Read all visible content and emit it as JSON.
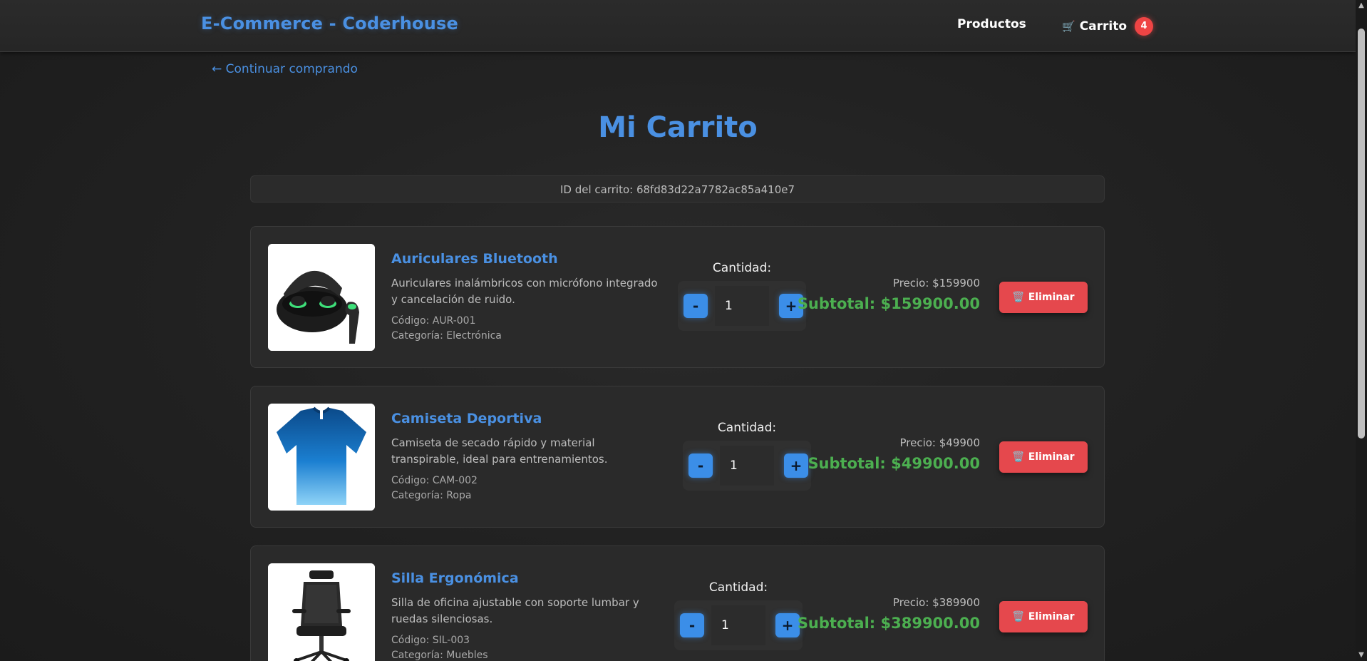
{
  "header": {
    "brand": "E-Commerce - Coderhouse",
    "nav_products": "Productos",
    "nav_cart": "Carrito",
    "cart_icon": "🛒",
    "cart_count": "4"
  },
  "back_link": "← Continuar comprando",
  "page_title": "Mi Carrito",
  "cart_id": "ID del carrito: 68fd83d22a7782ac85a410e7",
  "items": [
    {
      "name": "Auriculares Bluetooth",
      "description": "Auriculares inalámbricos con micrófono integrado y cancelación de ruido.",
      "code": "Código: AUR-001",
      "category": "Categoría: Electrónica",
      "qty_label": "Cantidad:",
      "minus": "-",
      "plus": "+",
      "quantity": "1",
      "price": "Precio: $159900",
      "subtotal": "Subtotal: $159900.00",
      "remove": "🗑️ Eliminar"
    },
    {
      "name": "Camiseta Deportiva",
      "description": "Camiseta de secado rápido y material transpirable, ideal para entrenamientos.",
      "code": "Código: CAM-002",
      "category": "Categoría: Ropa",
      "qty_label": "Cantidad:",
      "minus": "-",
      "plus": "+",
      "quantity": "1",
      "price": "Precio: $49900",
      "subtotal": "Subtotal: $49900.00",
      "remove": "🗑️ Eliminar"
    },
    {
      "name": "Silla Ergonómica",
      "description": "Silla de oficina ajustable con soporte lumbar y ruedas silenciosas.",
      "code": "Código: SIL-003",
      "category": "Categoría: Muebles",
      "qty_label": "Cantidad:",
      "minus": "-",
      "plus": "+",
      "quantity": "1",
      "price": "Precio: $389900",
      "subtotal": "Subtotal: $389900.00",
      "remove": "🗑️ Eliminar"
    }
  ],
  "colors": {
    "accent": "#4a90e2",
    "subtotal": "#4caf50",
    "danger": "#e5484d",
    "background": "#1f1f1f"
  }
}
